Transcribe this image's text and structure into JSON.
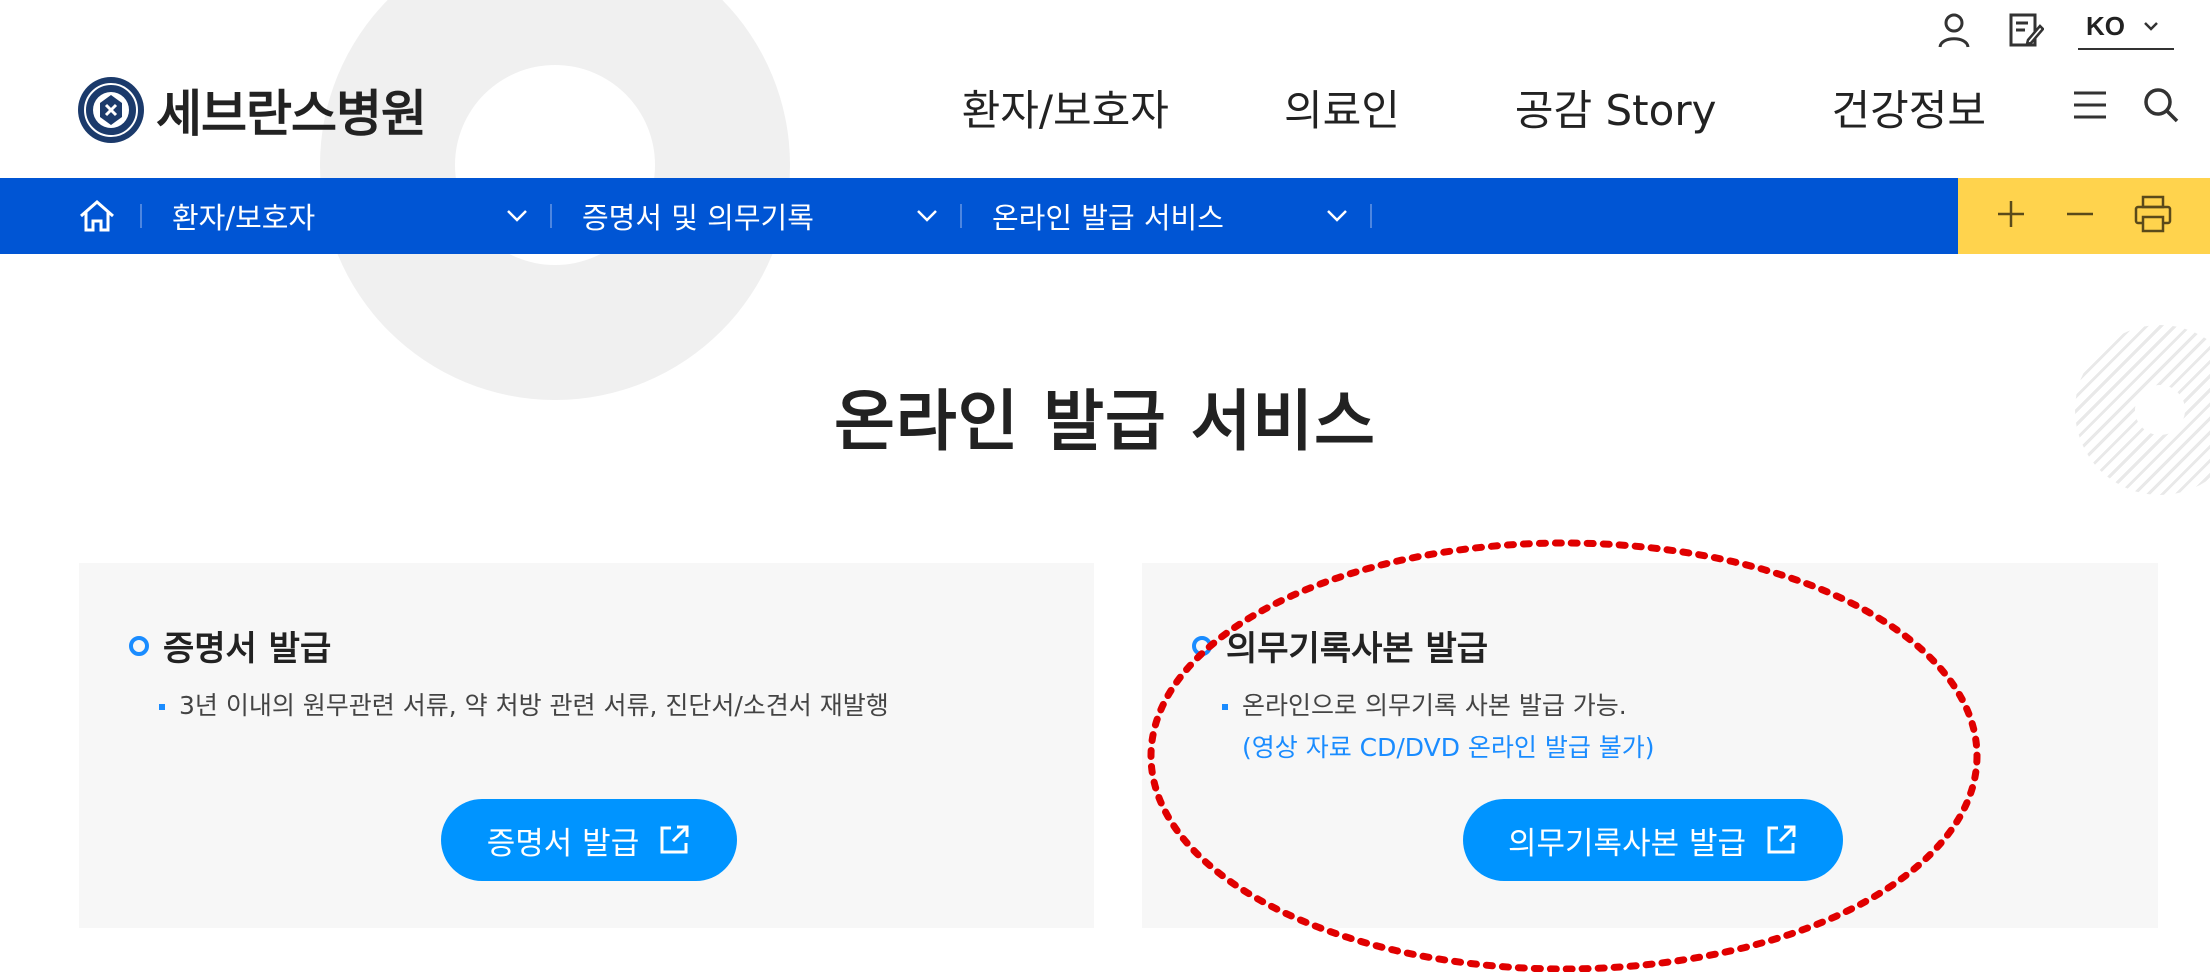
{
  "utility": {
    "user_icon": "user-icon",
    "edit_icon": "edit-icon",
    "language": "KO"
  },
  "header": {
    "logo_text": "세브란스병원",
    "nav": [
      "환자/보호자",
      "의료인",
      "공감 Story",
      "건강정보"
    ],
    "menu_icon": "hamburger-icon",
    "search_icon": "search-icon"
  },
  "breadcrumb": {
    "home_icon": "home-icon",
    "items": [
      "환자/보호자",
      "증명서 및 의무기록",
      "온라인 발급 서비스"
    ],
    "tools": [
      "plus-icon",
      "minus-icon",
      "print-icon"
    ]
  },
  "main": {
    "title": "온라인 발급 서비스",
    "cards": [
      {
        "title": "증명서 발급",
        "desc": "3년 이내의 원무관련 서류, 약 처방 관련 서류, 진단서/소견서 재발행",
        "note": "",
        "button": "증명서 발급"
      },
      {
        "title": "의무기록사본 발급",
        "desc": "온라인으로 의무기록 사본 발급 가능.",
        "note": "(영상 자료 CD/DVD 온라인 발급 불가)",
        "button": "의무기록사본 발급"
      }
    ]
  },
  "colors": {
    "nav_bar": "#0055d4",
    "tool_bar": "#ffd34d",
    "accent": "#0094ff",
    "annotation": "#e00000"
  }
}
